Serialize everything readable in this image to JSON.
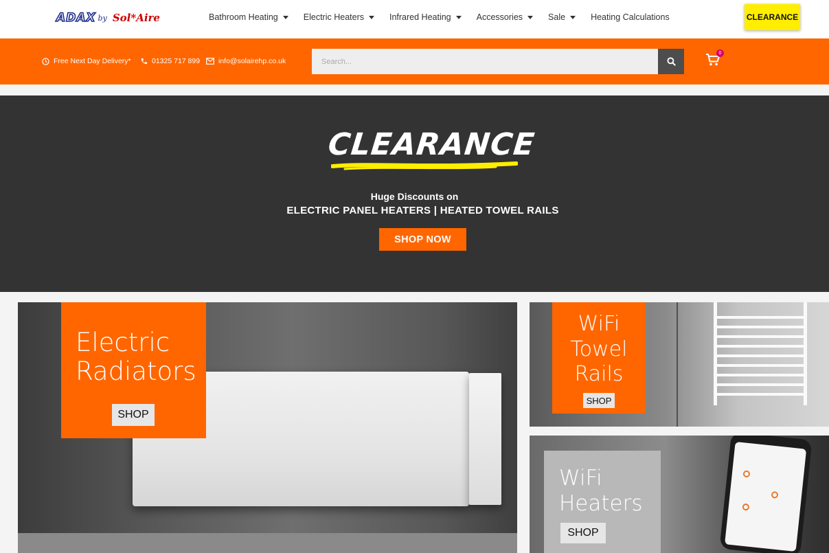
{
  "brand": {
    "logo_part1": "ADAX",
    "logo_by": "by",
    "logo_part2": "Sol*Aire"
  },
  "nav": {
    "items": [
      {
        "label": "Bathroom Heating",
        "has_dropdown": true
      },
      {
        "label": "Electric Heaters",
        "has_dropdown": true
      },
      {
        "label": "Infrared Heating",
        "has_dropdown": true
      },
      {
        "label": "Accessories",
        "has_dropdown": true
      },
      {
        "label": "Sale",
        "has_dropdown": true
      },
      {
        "label": "Heating Calculations",
        "has_dropdown": false
      }
    ],
    "clearance_label": "CLEARANCE"
  },
  "topbar": {
    "delivery": "Free Next Day Delivery*",
    "phone": "01325 717 899",
    "email": "info@solairehp.co.uk",
    "search_placeholder": "Search...",
    "cart_count": "0"
  },
  "hero": {
    "title": "CLEARANCE",
    "subtitle_line1": "Huge Discounts on",
    "subtitle_line2": "ELECTRIC PANEL HEATERS | HEATED TOWEL RAILS",
    "cta": "SHOP NOW"
  },
  "tiles": {
    "radiators": {
      "line1": "Electric",
      "line2": "Radiators",
      "shop": "SHOP"
    },
    "towel_rails": {
      "line1": "WiFi",
      "line2": "Towel",
      "line3": "Rails",
      "shop": "SHOP"
    },
    "heaters": {
      "line1": "WiFi",
      "line2": "Heaters",
      "shop": "SHOP"
    }
  },
  "colors": {
    "brand_orange": "#ff6600",
    "clearance_yellow": "#ffee00",
    "hero_bg": "#333333",
    "search_button": "#4d4d4d"
  }
}
